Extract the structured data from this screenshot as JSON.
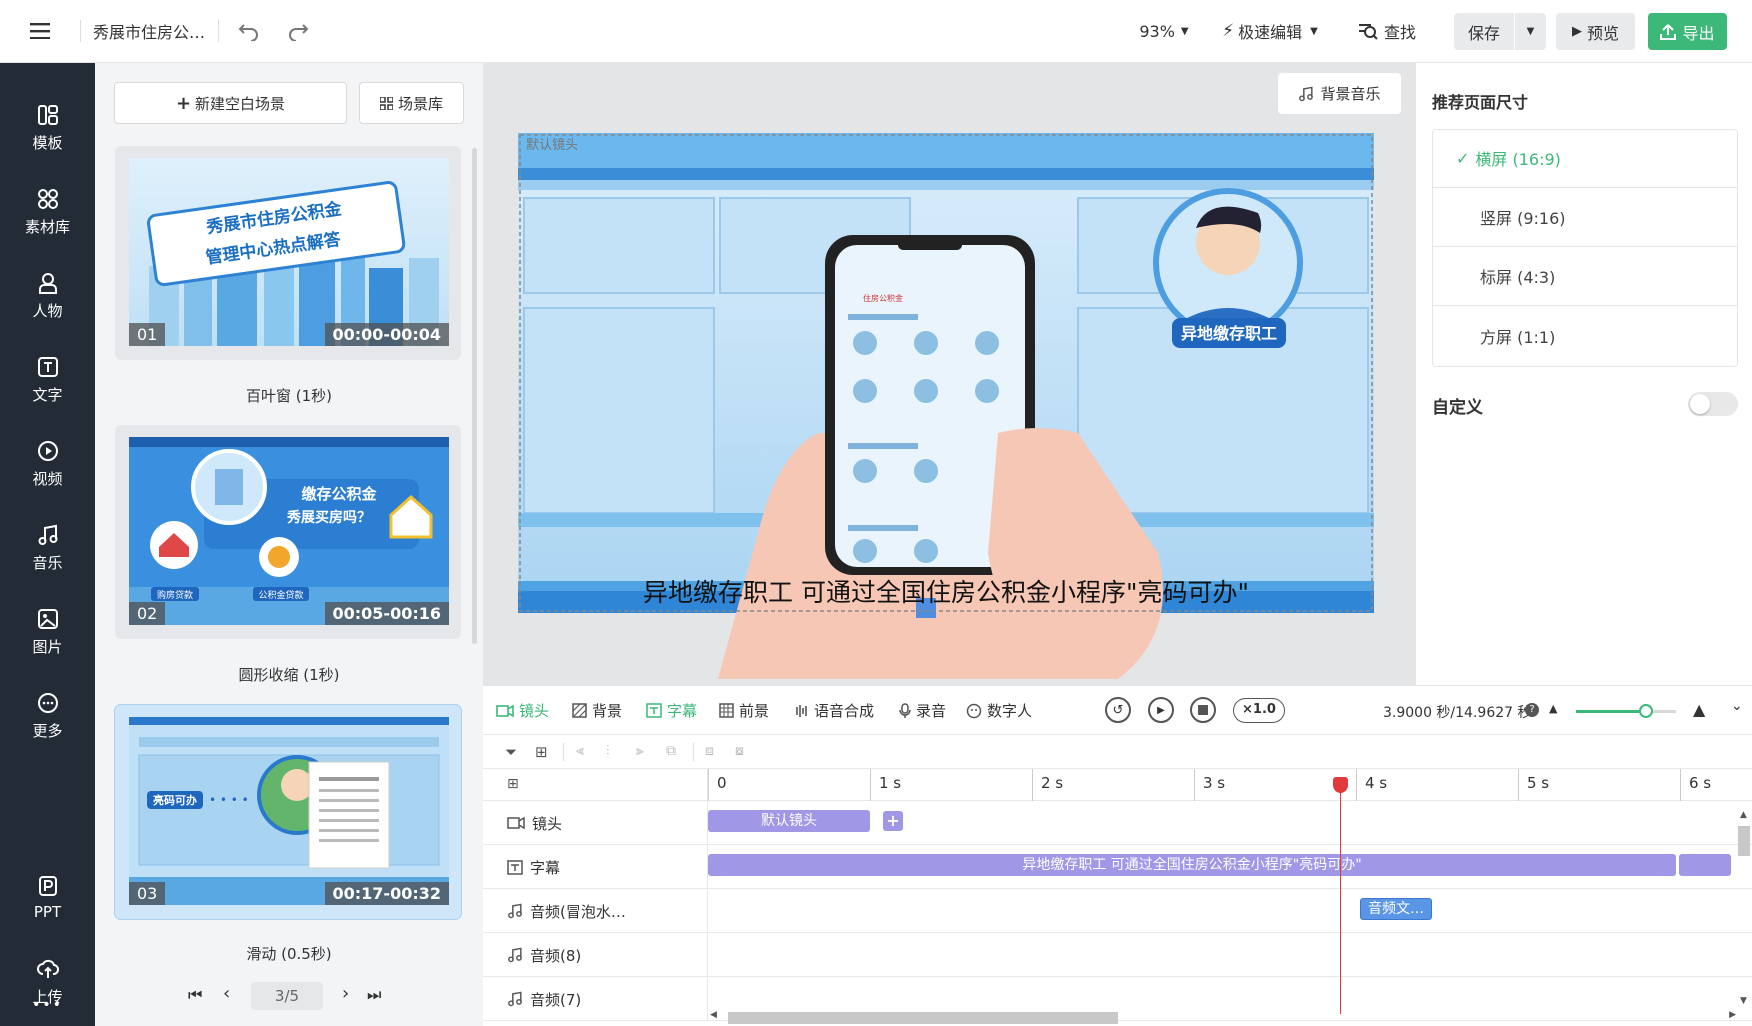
{
  "header": {
    "menu_icon": "menu-icon",
    "project_title": "秀展市住房公…",
    "zoom": "93%",
    "edit_mode": "极速编辑",
    "find": "查找",
    "save": "保存",
    "preview": "预览",
    "export": "导出",
    "colors": {
      "accent": "#3cb878"
    }
  },
  "sidebar": {
    "items": [
      {
        "label": "模板",
        "icon": "template-icon"
      },
      {
        "label": "素材库",
        "icon": "material-icon"
      },
      {
        "label": "人物",
        "icon": "person-icon"
      },
      {
        "label": "文字",
        "icon": "text-icon"
      },
      {
        "label": "视频",
        "icon": "video-icon"
      },
      {
        "label": "音乐",
        "icon": "music-icon"
      },
      {
        "label": "图片",
        "icon": "image-icon"
      },
      {
        "label": "更多",
        "icon": "more-icon"
      },
      {
        "label": "PPT",
        "icon": "ppt-icon"
      },
      {
        "label": "上传",
        "icon": "upload-icon"
      }
    ],
    "overflow": "•••"
  },
  "scenes": {
    "new_scene": "新建空白场景",
    "library": "场景库",
    "items": [
      {
        "num": "01",
        "duration": "00:00-00:04",
        "transition": "百叶窗 (1秒)",
        "banner1": "秀展市住房公积金",
        "banner2": "管理中心热点解答"
      },
      {
        "num": "02",
        "duration": "00:05-00:16",
        "transition": "圆形收缩 (1秒)",
        "text1": "缴存公积金",
        "text2": "秀展买房吗？",
        "badge1": "购房贷款",
        "badge2": "公积金贷款"
      },
      {
        "num": "03",
        "duration": "00:17-00:32",
        "transition": "滑动 (0.5秒)",
        "badge": "亮码可办"
      }
    ],
    "pager": {
      "current": "3/5"
    }
  },
  "canvas": {
    "bgm": "背景音乐",
    "lens_label": "默认镜头",
    "subtitle": "异地缴存职工 可通过全国住房公积金小程序\"亮码可办\"",
    "badge": "异地缴存职工",
    "phone_logo": "住房公积金"
  },
  "right_panel": {
    "title": "推荐页面尺寸",
    "options": [
      "横屏 (16:9)",
      "竖屏 (9:16)",
      "标屏 (4:3)",
      "方屏 (1:1)"
    ],
    "selected": 0,
    "custom": "自定义",
    "custom_on": false
  },
  "timeline": {
    "tabs": [
      "镜头",
      "背景",
      "字幕",
      "前景",
      "语音合成",
      "录音",
      "数字人"
    ],
    "speed": "×1.0",
    "time": "3.9000 秒/14.9627 秒",
    "ticks": [
      "0",
      "1 s",
      "2 s",
      "3 s",
      "4 s",
      "5 s",
      "6 s"
    ],
    "rows": [
      {
        "label": "镜头",
        "icon": "camera-icon"
      },
      {
        "label": "字幕",
        "icon": "subtitle-icon"
      },
      {
        "label": "音频(冒泡水…",
        "icon": "audio-icon"
      },
      {
        "label": "音频(8)",
        "icon": "audio-icon"
      },
      {
        "label": "音频(7)",
        "icon": "audio-icon"
      }
    ],
    "lens_clip": "默认镜头",
    "subtitle_clip": "异地缴存职工 可通过全国住房公积金小程序\"亮码可办\"",
    "audio_clip": "音频文…",
    "zoom_level": 0.7
  }
}
